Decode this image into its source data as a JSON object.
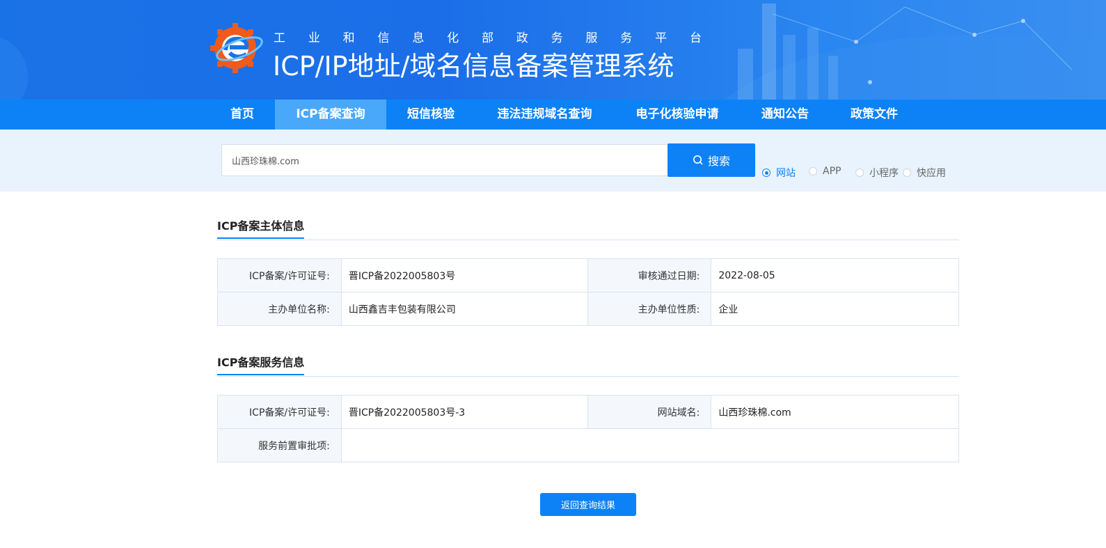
{
  "header": {
    "subtitle_chars": [
      "工",
      "业",
      "和",
      "信",
      "息",
      "化",
      "部",
      "政",
      "务",
      "服",
      "务",
      "平",
      "台"
    ],
    "title": "ICP/IP地址/域名信息备案管理系统"
  },
  "nav": {
    "items": [
      {
        "label": "首页"
      },
      {
        "label": "ICP备案查询"
      },
      {
        "label": "短信核验"
      },
      {
        "label": "违法违规域名查询"
      },
      {
        "label": "电子化核验申请"
      },
      {
        "label": "通知公告"
      },
      {
        "label": "政策文件"
      }
    ],
    "active_index": 1
  },
  "search": {
    "value": "山西珍珠棉.com",
    "button_label": "搜索",
    "types": [
      {
        "label": "网站",
        "checked": true
      },
      {
        "label": "APP",
        "checked": false
      },
      {
        "label": "小程序",
        "checked": false
      },
      {
        "label": "快应用",
        "checked": false
      }
    ]
  },
  "subject": {
    "title": "ICP备案主体信息",
    "license_label": "ICP备案/许可证号:",
    "license_value": "晋ICP备2022005803号",
    "date_label": "审核通过日期:",
    "date_value": "2022-08-05",
    "org_label": "主办单位名称:",
    "org_value": "山西鑫吉丰包装有限公司",
    "nature_label": "主办单位性质:",
    "nature_value": "企业"
  },
  "service": {
    "title": "ICP备案服务信息",
    "license_label": "ICP备案/许可证号:",
    "license_value": "晋ICP备2022005803号-3",
    "domain_label": "网站域名:",
    "domain_value": "山西珍珠棉.com",
    "approval_label": "服务前置审批项:",
    "approval_value": ""
  },
  "back_button": "返回查询结果",
  "colors": {
    "primary": "#0d82f7",
    "nav_active": "#4aa8fb",
    "search_band": "#e8f3fd",
    "logo_orange": "#f05a1a"
  }
}
